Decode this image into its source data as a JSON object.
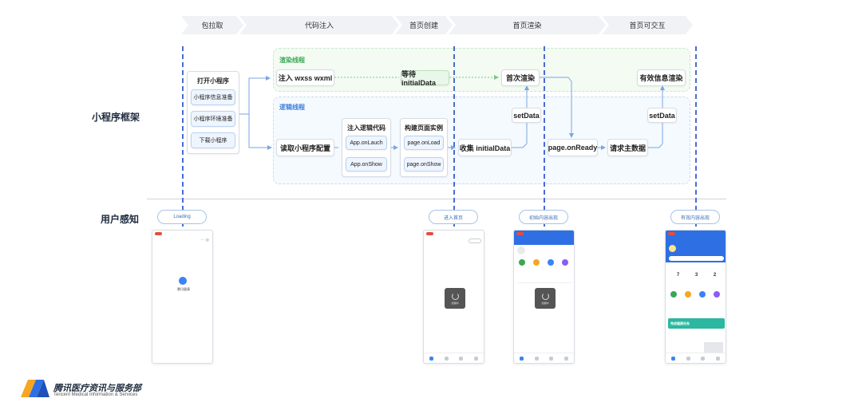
{
  "phases": [
    {
      "label": "包拉取"
    },
    {
      "label": "代码注入"
    },
    {
      "label": "首页创建"
    },
    {
      "label": "首页渲染"
    },
    {
      "label": "首页可交互"
    }
  ],
  "rows": {
    "framework": "小程序框架",
    "user": "用户感知"
  },
  "threads": {
    "render": "渲染线程",
    "logic": "逻辑线程"
  },
  "boot": {
    "title": "打开小程序",
    "items": [
      "小程序信息准备",
      "小程序环境准备",
      "下载小程序"
    ]
  },
  "render_nodes": {
    "inject": "注入 wxss wxml",
    "wait": "等待 initialData",
    "first_render": "首次渲染",
    "valid_render": "有效信息渲染"
  },
  "logic_nodes": {
    "read_config": "读取小程序配置",
    "inject_logic_title": "注入逻辑代码",
    "app_launch": "App.onLauch",
    "app_show": "App.onShow",
    "build_page_title": "构建页面实例",
    "page_load": "page.onLoad",
    "page_show": "page.onShow",
    "collect": "收集 initialData",
    "setdata1": "setData",
    "page_ready": "page.onReady",
    "request_main": "请求主数据",
    "setdata2": "setData"
  },
  "user_pills": {
    "loading": "Loading",
    "enter_home": "进入首页",
    "initial_content": "初始内容出现",
    "valid_content": "有效内容出现"
  },
  "phones": {
    "loading_app_name": "腾讯健康",
    "loader_text": "加载中",
    "card_values": [
      "7",
      "3",
      "2"
    ],
    "banner_text": "完成健康任务"
  },
  "branding": {
    "name_cn": "腾讯医疗资讯与服务部",
    "name_en": "Tencent Medical Information & Services",
    "colors": {
      "orange": "#f5a623",
      "blue": "#2f6fe4"
    }
  },
  "colors": {
    "guide_line": "#4b6bd6",
    "render_title": "#3aa757",
    "logic_title": "#3b7ddd"
  }
}
